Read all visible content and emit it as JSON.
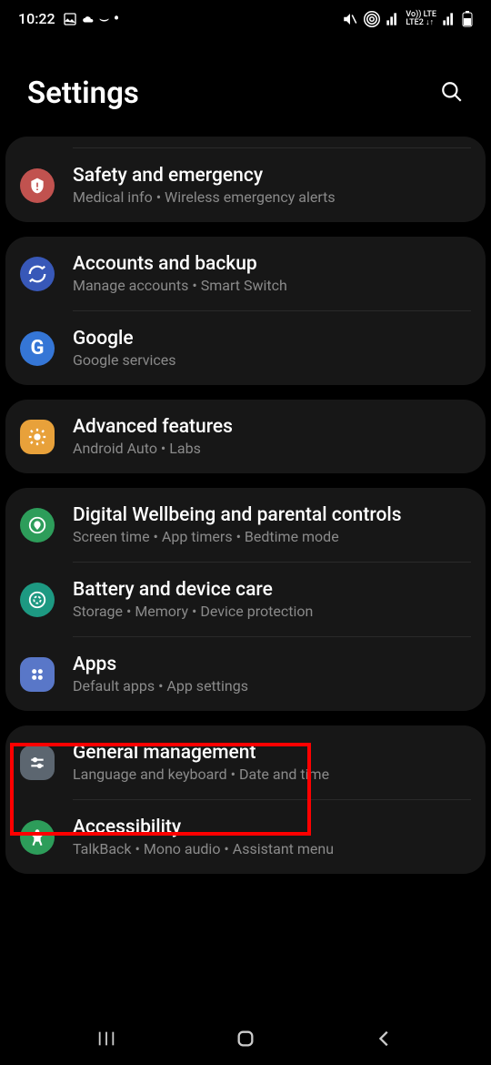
{
  "status": {
    "time": "10:22",
    "network": "Vo)) LTE",
    "network2": "LTE2"
  },
  "header": {
    "title": "Settings"
  },
  "groups": [
    {
      "items": [
        {
          "title": "Safety and emergency",
          "sub": "Medical info  •  Wireless emergency alerts",
          "iconBg": "#c1524f",
          "iconShape": "round",
          "iconName": "safety-icon"
        }
      ],
      "topDivider": true
    },
    {
      "items": [
        {
          "title": "Accounts and backup",
          "sub": "Manage accounts  •  Smart Switch",
          "iconBg": "#3858b8",
          "iconShape": "round",
          "iconName": "sync-icon"
        },
        {
          "title": "Google",
          "sub": "Google services",
          "iconBg": "#3576d6",
          "iconShape": "round",
          "iconName": "google-icon"
        }
      ]
    },
    {
      "items": [
        {
          "title": "Advanced features",
          "sub": "Android Auto  •  Labs",
          "iconBg": "#e8a13a",
          "iconShape": "squircle",
          "iconName": "advanced-icon"
        }
      ]
    },
    {
      "items": [
        {
          "title": "Digital Wellbeing and parental controls",
          "sub": "Screen time  •  App timers  •  Bedtime mode",
          "iconBg": "#2d9d5a",
          "iconShape": "round",
          "iconName": "wellbeing-icon"
        },
        {
          "title": "Battery and device care",
          "sub": "Storage  •  Memory  •  Device protection",
          "iconBg": "#1d9982",
          "iconShape": "round",
          "iconName": "battery-icon"
        },
        {
          "title": "Apps",
          "sub": "Default apps  •  App settings",
          "iconBg": "#5977c8",
          "iconShape": "squircle",
          "iconName": "apps-icon"
        }
      ]
    },
    {
      "items": [
        {
          "title": "General management",
          "sub": "Language and keyboard  •  Date and time",
          "iconBg": "#5c6670",
          "iconShape": "squircle",
          "iconName": "general-icon"
        },
        {
          "title": "Accessibility",
          "sub": "TalkBack  •  Mono audio  •  Assistant menu",
          "iconBg": "#2d9d5a",
          "iconShape": "round",
          "iconName": "accessibility-icon"
        }
      ]
    }
  ]
}
